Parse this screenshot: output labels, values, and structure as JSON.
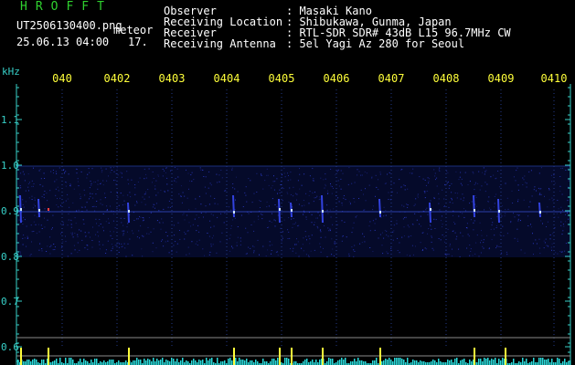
{
  "header": {
    "brand": "HROFFT",
    "filename": "UT2506130400.png",
    "tag": "meteor",
    "datetime": "25.06.13 04:00",
    "count": "17.",
    "info": [
      {
        "label": "Observer",
        "value": ": Masaki Kano"
      },
      {
        "label": "Receiving Location",
        "value": ": Shibukawa, Gunma, Japan"
      },
      {
        "label": "Receiver",
        "value": ": RTL-SDR SDR# 43dB L15 96.7MHz CW"
      },
      {
        "label": "Receiving Antenna",
        "value": ": 5el Yagi Az 280 for Seoul"
      }
    ]
  },
  "spectrogram": {
    "yunit": "kHz",
    "ytick_labels": [
      "1.1",
      "1.0",
      "0.9",
      "0.8",
      "0.7",
      "0.6"
    ],
    "xtick_labels": [
      "040",
      "0402",
      "0403",
      "0404",
      "0405",
      "0406",
      "0407",
      "0408",
      "0409",
      "0410"
    ],
    "colors": {
      "axis": "#37d0c8",
      "time_labels": "#ffff3a",
      "grid": "#243a8a",
      "signal": "#3a4cff",
      "echo": "#cfe6ff",
      "meter": "#2ad9d9",
      "meter_peak": "#ffff3a"
    }
  }
}
